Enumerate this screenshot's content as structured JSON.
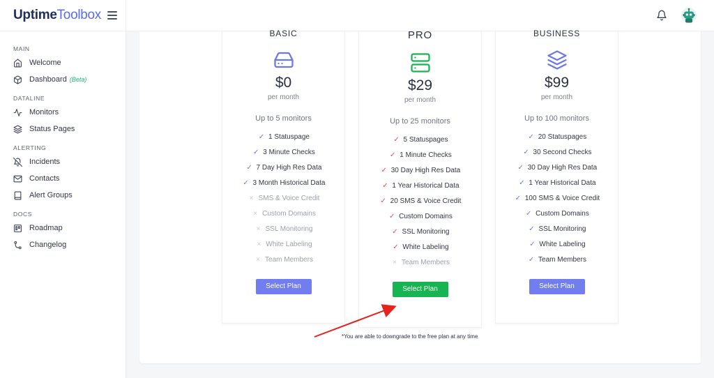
{
  "brand": {
    "strong": "Uptime",
    "light": "Toolbox"
  },
  "sidebar": {
    "sections": [
      {
        "heading": "MAIN",
        "items": [
          {
            "label": "Welcome",
            "icon": "home-icon"
          },
          {
            "label": "Dashboard",
            "badge": "(Beta)",
            "icon": "cube-icon"
          }
        ]
      },
      {
        "heading": "DATALINE",
        "items": [
          {
            "label": "Monitors",
            "icon": "activity-icon"
          },
          {
            "label": "Status Pages",
            "icon": "layers-icon"
          }
        ]
      },
      {
        "heading": "ALERTING",
        "items": [
          {
            "label": "Incidents",
            "icon": "bell-off-icon"
          },
          {
            "label": "Contacts",
            "icon": "mail-icon"
          },
          {
            "label": "Alert Groups",
            "icon": "book-icon"
          }
        ]
      },
      {
        "heading": "DOCS",
        "items": [
          {
            "label": "Roadmap",
            "icon": "trello-icon"
          },
          {
            "label": "Changelog",
            "icon": "git-branch-icon"
          }
        ]
      }
    ]
  },
  "plans": {
    "basic": {
      "name": "BASIC",
      "price": "$0",
      "period": "per month",
      "limit": "Up to 5 monitors",
      "button": "Select Plan",
      "features": [
        {
          "label": "1 Statuspage",
          "on": true
        },
        {
          "label": "3 Minute Checks",
          "on": true
        },
        {
          "label": "7 Day High Res Data",
          "on": true
        },
        {
          "label": "3 Month Historical Data",
          "on": true
        },
        {
          "label": "SMS & Voice Credit",
          "on": false
        },
        {
          "label": "Custom Domains",
          "on": false
        },
        {
          "label": "SSL Monitoring",
          "on": false
        },
        {
          "label": "White Labeling",
          "on": false
        },
        {
          "label": "Team Members",
          "on": false
        }
      ]
    },
    "pro": {
      "name": "PRO",
      "price": "$29",
      "period": "per month",
      "limit": "Up to 25 monitors",
      "button": "Select Plan",
      "features": [
        {
          "label": "5 Statuspages",
          "on": true
        },
        {
          "label": "1 Minute Checks",
          "on": true
        },
        {
          "label": "30 Day High Res Data",
          "on": true
        },
        {
          "label": "1 Year Historical Data",
          "on": true
        },
        {
          "label": "20 SMS & Voice Credit",
          "on": true
        },
        {
          "label": "Custom Domains",
          "on": true
        },
        {
          "label": "SSL Monitoring",
          "on": true
        },
        {
          "label": "White Labeling",
          "on": true
        },
        {
          "label": "Team Members",
          "on": false
        }
      ]
    },
    "business": {
      "name": "BUSINESS",
      "price": "$99",
      "period": "per month",
      "limit": "Up to 100 monitors",
      "button": "Select Plan",
      "features": [
        {
          "label": "20 Statuspages",
          "on": true
        },
        {
          "label": "30 Second Checks",
          "on": true
        },
        {
          "label": "30 Day High Res Data",
          "on": true
        },
        {
          "label": "1 Year Historical Data",
          "on": true
        },
        {
          "label": "100 SMS & Voice Credit",
          "on": true
        },
        {
          "label": "Custom Domains",
          "on": true
        },
        {
          "label": "SSL Monitoring",
          "on": true
        },
        {
          "label": "White Labeling",
          "on": true
        },
        {
          "label": "Team Members",
          "on": true
        }
      ]
    }
  },
  "note": "*You are able to downgrade to the free plan at any time",
  "colors": {
    "accent_blue": "#727ef0",
    "accent_green": "#17b552",
    "check_red": "#e5485f",
    "annotation_arrow": "#e8221c"
  }
}
